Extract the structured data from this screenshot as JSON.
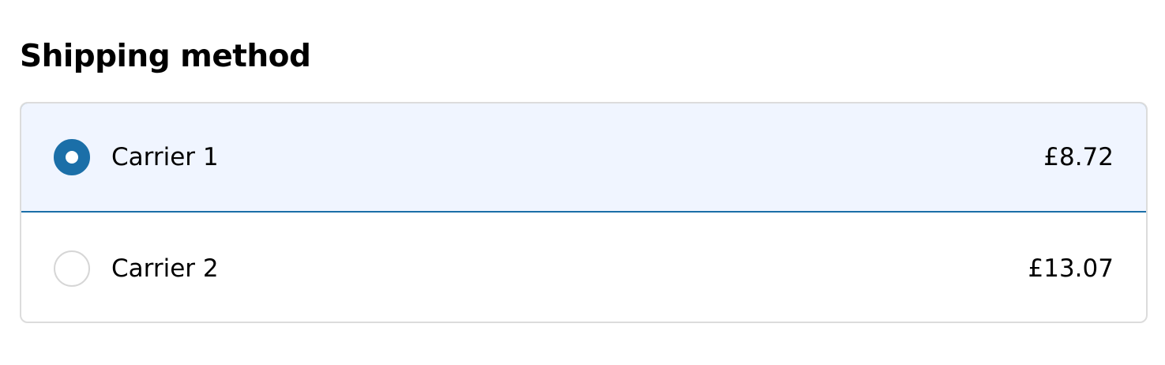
{
  "shipping": {
    "title": "Shipping method",
    "options": [
      {
        "label": "Carrier 1",
        "price": "£8.72",
        "selected": true
      },
      {
        "label": "Carrier 2",
        "price": "£13.07",
        "selected": false
      }
    ]
  },
  "colors": {
    "accent": "#1b6fa8",
    "selected_background": "#f0f5ff",
    "border": "#dcdcdc"
  }
}
